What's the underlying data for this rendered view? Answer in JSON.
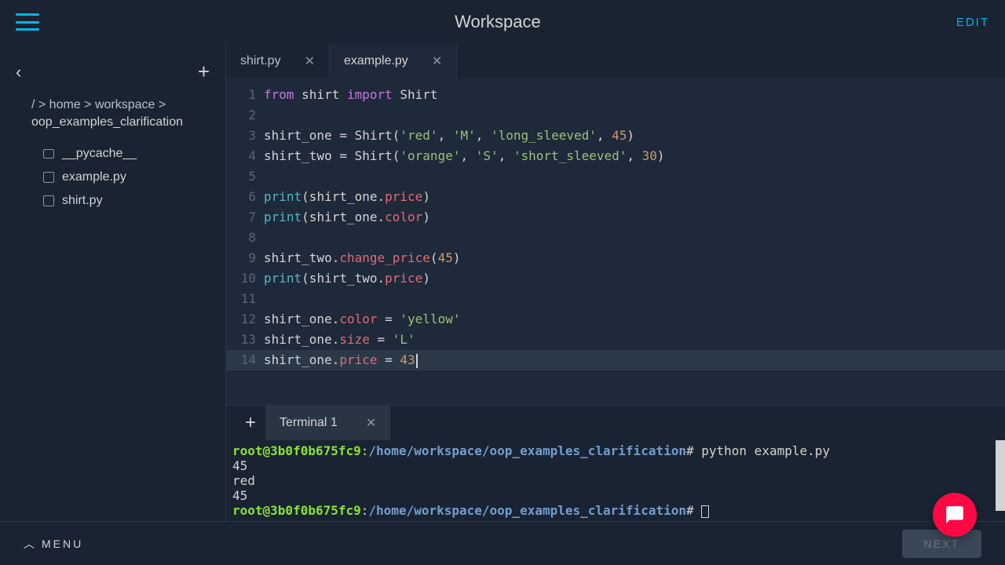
{
  "topbar": {
    "title": "Workspace",
    "edit": "EDIT"
  },
  "sidebar": {
    "breadcrumb": "/ > home > workspace >",
    "current_folder": "oop_examples_clarification",
    "files": [
      {
        "name": "__pycache__",
        "type": "folder"
      },
      {
        "name": "example.py",
        "type": "file"
      },
      {
        "name": "shirt.py",
        "type": "file"
      }
    ]
  },
  "editor": {
    "tabs": [
      {
        "name": "shirt.py",
        "active": false
      },
      {
        "name": "example.py",
        "active": true
      }
    ],
    "lines": [
      {
        "n": 1,
        "tokens": [
          [
            "kw",
            "from"
          ],
          [
            "",
            " shirt "
          ],
          [
            "kw",
            "import"
          ],
          [
            "",
            " Shirt"
          ]
        ]
      },
      {
        "n": 2,
        "tokens": []
      },
      {
        "n": 3,
        "tokens": [
          [
            "",
            "shirt_one = Shirt("
          ],
          [
            "str",
            "'red'"
          ],
          [
            "",
            ", "
          ],
          [
            "str",
            "'M'"
          ],
          [
            "",
            ", "
          ],
          [
            "str",
            "'long_sleeved'"
          ],
          [
            "",
            ", "
          ],
          [
            "num",
            "45"
          ],
          [
            "",
            ")"
          ]
        ]
      },
      {
        "n": 4,
        "tokens": [
          [
            "",
            "shirt_two = Shirt("
          ],
          [
            "str",
            "'orange'"
          ],
          [
            "",
            ", "
          ],
          [
            "str",
            "'S'"
          ],
          [
            "",
            ", "
          ],
          [
            "str",
            "'short_sleeved'"
          ],
          [
            "",
            ", "
          ],
          [
            "num",
            "30"
          ],
          [
            "",
            ")"
          ]
        ]
      },
      {
        "n": 5,
        "tokens": []
      },
      {
        "n": 6,
        "tokens": [
          [
            "builtin",
            "print"
          ],
          [
            "",
            "(shirt_one."
          ],
          [
            "attr",
            "price"
          ],
          [
            "",
            ")"
          ]
        ]
      },
      {
        "n": 7,
        "tokens": [
          [
            "builtin",
            "print"
          ],
          [
            "",
            "(shirt_one."
          ],
          [
            "attr",
            "color"
          ],
          [
            "",
            ")"
          ]
        ]
      },
      {
        "n": 8,
        "tokens": []
      },
      {
        "n": 9,
        "tokens": [
          [
            "",
            "shirt_two."
          ],
          [
            "attr",
            "change_price"
          ],
          [
            "",
            "("
          ],
          [
            "num",
            "45"
          ],
          [
            "",
            ")"
          ]
        ]
      },
      {
        "n": 10,
        "tokens": [
          [
            "builtin",
            "print"
          ],
          [
            "",
            "(shirt_two."
          ],
          [
            "attr",
            "price"
          ],
          [
            "",
            ")"
          ]
        ]
      },
      {
        "n": 11,
        "tokens": []
      },
      {
        "n": 12,
        "tokens": [
          [
            "",
            "shirt_one."
          ],
          [
            "attr",
            "color"
          ],
          [
            "",
            " = "
          ],
          [
            "str",
            "'yellow'"
          ]
        ]
      },
      {
        "n": 13,
        "tokens": [
          [
            "",
            "shirt_one."
          ],
          [
            "attr",
            "size"
          ],
          [
            "",
            " = "
          ],
          [
            "str",
            "'L'"
          ]
        ]
      },
      {
        "n": 14,
        "tokens": [
          [
            "",
            "shirt_one."
          ],
          [
            "attr",
            "price"
          ],
          [
            "",
            " = "
          ],
          [
            "num",
            "43"
          ]
        ],
        "highlighted": true,
        "cursor": true
      }
    ]
  },
  "terminal": {
    "tab_label": "Terminal 1",
    "prompt_user": "root@3b0f0b675fc9",
    "prompt_path": "/home/workspace/oop_examples_clarification",
    "command": "python example.py",
    "output": [
      "45",
      "red",
      "45"
    ]
  },
  "bottombar": {
    "menu": "MENU",
    "next": "NEXT"
  }
}
